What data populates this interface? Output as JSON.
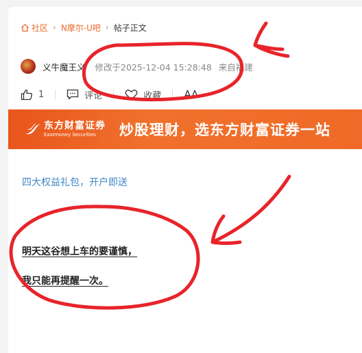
{
  "breadcrumb": {
    "home_label": "社区",
    "forum_label": "N摩尔-U吧",
    "current_label": "帖子正文"
  },
  "post": {
    "author_name": "义牛魔王义",
    "modified_time": "修改于2025-12-04 15:28:48",
    "location": "来自福建",
    "like_count": "1",
    "comment_label": "评论",
    "collect_label": "收藏",
    "font_label": "AA"
  },
  "banner": {
    "logo_cn": "东方财富证券",
    "logo_en": "Eastmoney Securities",
    "slogan": "炒股理财，选东方财富证券一站"
  },
  "content": {
    "promo_link": "四大权益礼包，开户即送",
    "line1": "明天这谷想上车的要谨慎，",
    "line2": "我只能再提醒一次。"
  },
  "colors": {
    "accent": "#e86a2b",
    "banner": "#ef6a26",
    "link": "#3f88c5",
    "annotation": "#e8242a"
  }
}
